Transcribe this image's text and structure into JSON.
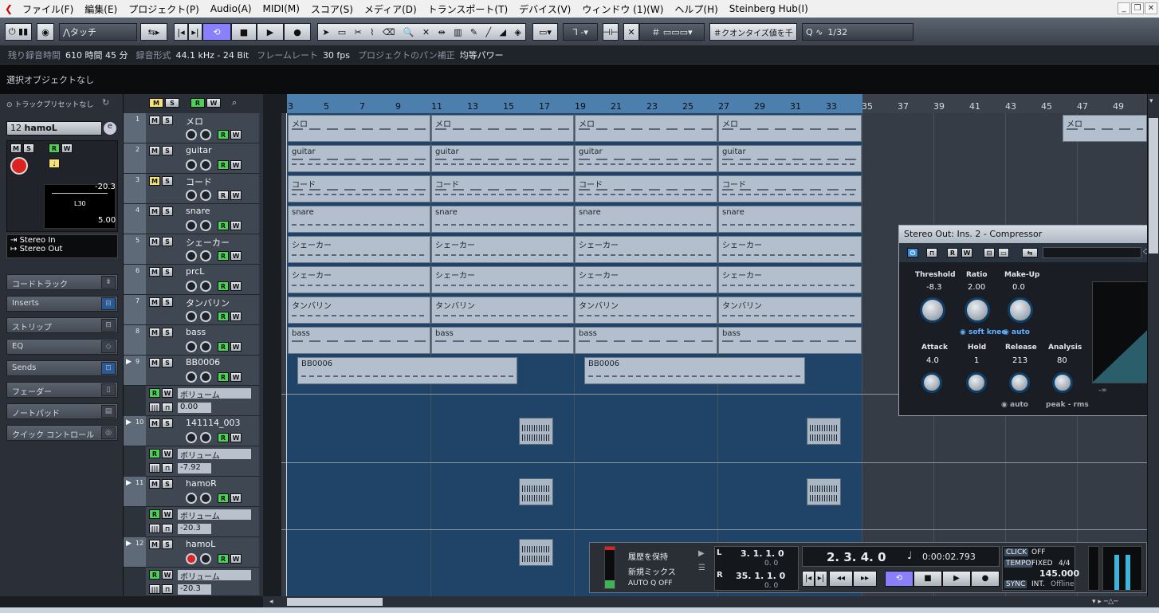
{
  "menu": [
    "ファイル(F)",
    "編集(E)",
    "プロジェクト(P)",
    "Audio(A)",
    "MIDI(M)",
    "スコア(S)",
    "メディア(D)",
    "トランスポート(T)",
    "デバイス(V)",
    "ウィンドウ (1)(W)",
    "ヘルプ(H)",
    "Steinberg Hub(I)"
  ],
  "toolbar": {
    "touch_mode": "タッチ",
    "quantize_label": "クオンタイズ値を千",
    "quantize_value": "1/32"
  },
  "infobar": [
    {
      "label": "残り録音時間",
      "value": "610 時間 45 分"
    },
    {
      "label": "録音形式",
      "value": "44.1 kHz - 24 Bit"
    },
    {
      "label": "フレームレート",
      "value": "30 fps"
    },
    {
      "label": "プロジェクトのパン補正",
      "value": "均等パワー"
    }
  ],
  "selection_text": "選択オブジェクトなし",
  "inspector": {
    "preset_label": "トラックプリセットなし",
    "track_num": "12",
    "track_name": "hamoL",
    "volume": "-20.3",
    "pan": "L30",
    "delay": "5.00",
    "input": "Stereo In",
    "output": "Stereo Out",
    "sections": [
      "コードトラック",
      "Inserts",
      "ストリップ",
      "EQ",
      "Sends",
      "フェーダー",
      "ノートパッド",
      "クイック コントロール"
    ]
  },
  "tracks": [
    {
      "num": "1",
      "name": "メロ"
    },
    {
      "num": "2",
      "name": "guitar"
    },
    {
      "num": "3",
      "name": "コード"
    },
    {
      "num": "4",
      "name": "snare"
    },
    {
      "num": "5",
      "name": "シェーカー"
    },
    {
      "num": "6",
      "name": "prcL"
    },
    {
      "num": "7",
      "name": "タンバリン"
    },
    {
      "num": "8",
      "name": "bass"
    },
    {
      "num": "9",
      "name": "BB0006",
      "auto_label": "ボリューム",
      "auto_value": "0.00"
    },
    {
      "num": "10",
      "name": "141114_003",
      "auto_label": "ボリューム",
      "auto_value": "-7.92"
    },
    {
      "num": "11",
      "name": "hamoR",
      "auto_label": "ボリューム",
      "auto_value": "-20.3"
    },
    {
      "num": "12",
      "name": "hamoL",
      "auto_label": "ボリューム",
      "auto_value": "-20.3"
    }
  ],
  "ruler_ticks": [
    "3",
    "5",
    "7",
    "9",
    "11",
    "13",
    "15",
    "17",
    "19",
    "21",
    "23",
    "25",
    "27",
    "29",
    "31",
    "33",
    "35",
    "37",
    "39",
    "41",
    "43",
    "45",
    "47",
    "49"
  ],
  "parts": {
    "melo": "メロ",
    "guitar": "guitar",
    "chord": "コード",
    "snare": "snare",
    "shaker": "シェーカー",
    "tamb": "タンバリン",
    "bass": "bass",
    "bb": "BB0006"
  },
  "plugin": {
    "title": "Stereo Out: Ins. 2 - Compressor",
    "threshold_label": "Threshold",
    "threshold": "-8.3",
    "ratio_label": "Ratio",
    "ratio": "2.00",
    "makeup_label": "Make-Up",
    "makeup": "0.0",
    "softknee": "soft knee",
    "auto1": "auto",
    "attack_label": "Attack",
    "attack": "4.0",
    "hold_label": "Hold",
    "hold": "1",
    "release_label": "Release",
    "release": "213",
    "analysis_label": "Analysis",
    "analysis": "80",
    "auto2": "auto",
    "peakrms": "peak - rms",
    "inf": "-∞"
  },
  "transport": {
    "keep_history": "履歴を保持",
    "new_mix": "新規ミックス",
    "autoq": "AUTO Q",
    "autoq_state": "OFF",
    "left_locator": "3. 1. 1.   0",
    "left_sub": "0. 0",
    "right_locator": "35. 1. 1.   0",
    "right_sub": "0. 0",
    "position": "2. 3. 4.   0",
    "time": "0:00:02.793",
    "click": "CLICK",
    "click_state": "OFF",
    "tempo": "TEMPO",
    "tempo_mode": "FIXED",
    "sig": "4/4",
    "bpm": "145.000",
    "sync": "SYNC",
    "sync_mode": "INT.",
    "sync_state": "Offline"
  }
}
